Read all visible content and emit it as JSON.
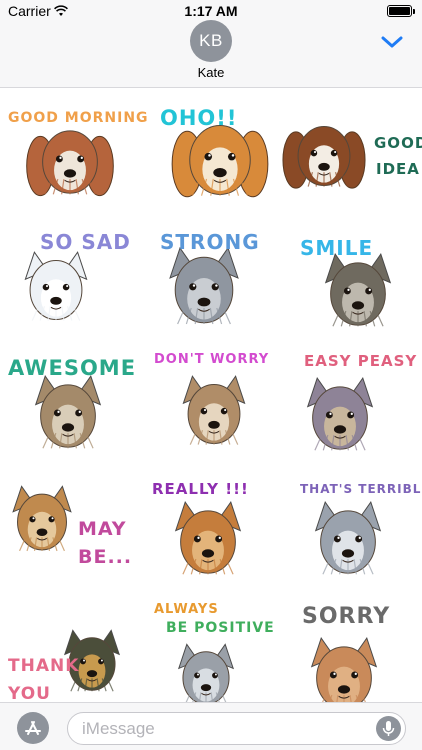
{
  "status_bar": {
    "carrier": "Carrier",
    "time": "1:17 AM",
    "battery_percent": 100
  },
  "header": {
    "avatar_initials": "KB",
    "contact_name": "Kate",
    "expand_icon": "chevron-down-icon"
  },
  "stickers": [
    {
      "caption": "GOOD MORNING",
      "caption2": "",
      "caption_color": "#f0a04a",
      "caption2_color": "",
      "fur": "#b5643c",
      "face": "#efe6da",
      "dog": "beagle"
    },
    {
      "caption": "OHO!!",
      "caption2": "",
      "caption_color": "#22c4d6",
      "caption2_color": "",
      "fur": "#d88a3a",
      "face": "#f5e8d2",
      "dog": "beagle"
    },
    {
      "caption": "GOOD",
      "caption2": "IDEA",
      "caption_color": "#1f6b55",
      "caption2_color": "#1f6b55",
      "fur": "#8a4a26",
      "face": "#f3ede4",
      "dog": "beagle"
    },
    {
      "caption": "SO SAD",
      "caption2": "",
      "caption_color": "#8a87d6",
      "caption2_color": "",
      "fur": "#eef2f6",
      "face": "#ffffff",
      "dog": "terrier"
    },
    {
      "caption": "STRONG",
      "caption2": "",
      "caption_color": "#5a97d8",
      "caption2_color": "",
      "fur": "#8f96a0",
      "face": "#c9cdd2",
      "dog": "schnauzer"
    },
    {
      "caption": "SMILE",
      "caption2": "",
      "caption_color": "#36b6e8",
      "caption2_color": "",
      "fur": "#6f6a5f",
      "face": "#bdb8ad",
      "dog": "schnauzer"
    },
    {
      "caption": "AWESOME",
      "caption2": "",
      "caption_color": "#2aa88a",
      "caption2_color": "",
      "fur": "#a48a6a",
      "face": "#d9cdb8",
      "dog": "yorkie"
    },
    {
      "caption": "DON'T WORRY",
      "caption2": "",
      "caption_color": "#d34bcf",
      "caption2_color": "",
      "fur": "#b08d68",
      "face": "#e6d6bf",
      "dog": "yorkie"
    },
    {
      "caption": "EASY PEASY",
      "caption2": "",
      "caption_color": "#e0607e",
      "caption2_color": "",
      "fur": "#8e8397",
      "face": "#c8b69c",
      "dog": "yorkie"
    },
    {
      "caption": "MAY",
      "caption2": "BE...",
      "caption_color": "#c14a9c",
      "caption2_color": "#c14a9c",
      "fur": "#c08a4e",
      "face": "#e5c89c",
      "dog": "yorkie"
    },
    {
      "caption": "REALLY !!!",
      "caption2": "",
      "caption_color": "#8e2fb0",
      "caption2_color": "",
      "fur": "#c57d3c",
      "face": "#e3b47a",
      "dog": "yorkie"
    },
    {
      "caption": "THAT'S TERRIBLE!",
      "caption2": "",
      "caption_color": "#7d63b8",
      "caption2_color": "",
      "fur": "#9aa2ad",
      "face": "#dfe3e8",
      "dog": "terrier"
    },
    {
      "caption": "THANK",
      "caption2": "YOU",
      "caption_color": "#e46a8a",
      "caption2_color": "#e46a8a",
      "fur": "#4b4e3a",
      "face": "#c79a4e",
      "dog": "yorkie"
    },
    {
      "caption": "ALWAYS",
      "caption2": "BE POSITIVE",
      "caption_color": "#e89a2f",
      "caption2_color": "#3fae5d",
      "fur": "#9aa0a8",
      "face": "#d8dde2",
      "dog": "schnauzer"
    },
    {
      "caption": "SORRY",
      "caption2": "",
      "caption_color": "#6a6a6a",
      "caption2_color": "",
      "fur": "#c98a5a",
      "face": "#e0b083",
      "dog": "poodle"
    }
  ],
  "input_bar": {
    "placeholder": "iMessage",
    "value": "",
    "app_icon": "app-store-icon",
    "mic_icon": "microphone-icon"
  }
}
